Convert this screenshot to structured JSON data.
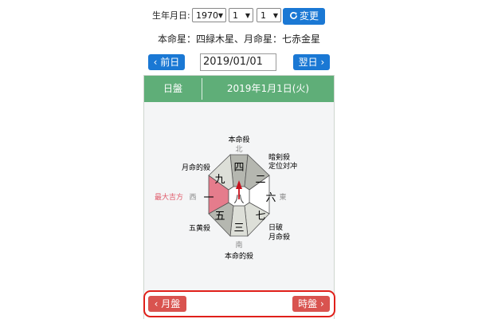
{
  "birth": {
    "label": "生年月日:",
    "year": "1970",
    "month": "1",
    "day": "1",
    "change_label": "変更",
    "change_icon": "refresh-icon"
  },
  "info_line": "本命星：四緑木星、月命星：七赤金星",
  "nav": {
    "prev_label": "前日",
    "next_label": "翌日",
    "date_value": "2019/01/01"
  },
  "panel": {
    "header_label": "日盤",
    "header_date": "2019年1月1日(火)"
  },
  "board": {
    "cells": {
      "north": "四",
      "northeast": "二",
      "east": "六",
      "southeast": "七",
      "south": "三",
      "southwest": "五",
      "west": "一",
      "northwest": "九",
      "center": "八"
    },
    "directions": {
      "north": "北",
      "south": "南",
      "east": "東",
      "west": "西"
    },
    "annotations": {
      "north": "本命殺",
      "northeast_1": "暗剣殺",
      "northeast_2": "定位対冲",
      "northwest": "月命的殺",
      "west": "最大吉方",
      "southwest": "五黄殺",
      "southeast_1": "日破",
      "southeast_2": "月命殺",
      "south": "本命的殺"
    },
    "colors": {
      "dark_gray": "#b5b7b0",
      "light_gray": "#dddfd8",
      "white": "#ffffff",
      "lucky_pink": "#e57c8c",
      "arrow_red": "#c8101c",
      "annotation_red": "#e05a6a"
    }
  },
  "footer": {
    "month_label": "月盤",
    "hour_label": "時盤"
  }
}
